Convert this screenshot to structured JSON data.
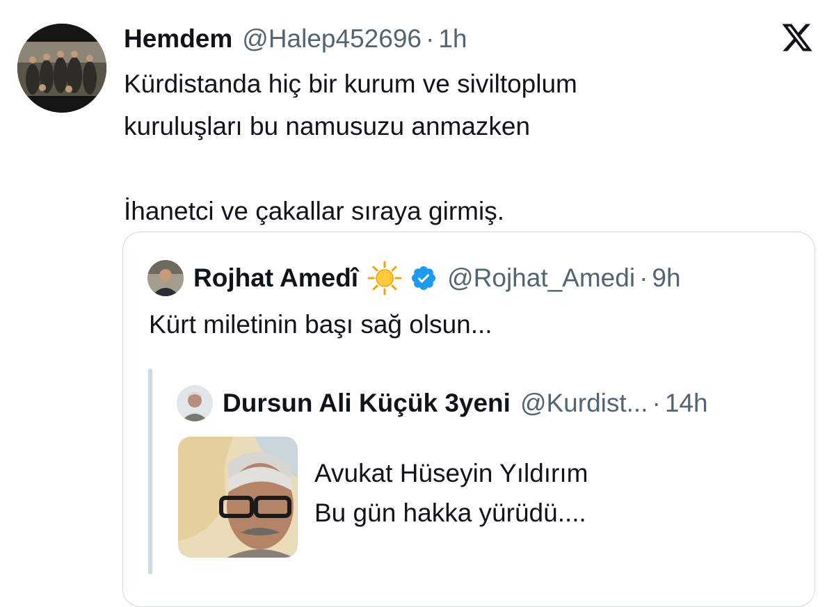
{
  "tweet": {
    "author_name": "Hemdem",
    "handle": "@Halep452696",
    "separator": "·",
    "time": "1h",
    "text_lines": [
      "Kürdistanda hiç bir kurum ve  siviltoplum",
      "kuruluşları bu  namusuzu  anmazken",
      "",
      "İhanetci  ve çakallar sıraya girmiş."
    ]
  },
  "quoted": {
    "author_name": "Rojhat Amedî",
    "handle": "@Rojhat_Amedi",
    "separator": "·",
    "time": "9h",
    "text": "Kürt miletinin başı sağ olsun..."
  },
  "nested": {
    "author_name": "Dursun Ali Küçük 3yeni",
    "handle": "@Kurdist...",
    "separator": "·",
    "time": "14h",
    "text_lines": [
      "Avukat Hüseyin Yıldırım",
      "Bu gün hakka yürüdü...."
    ]
  },
  "icons": {
    "platform_logo": "x-logo-icon",
    "verified": "verified-badge-icon",
    "emoji": "sun-emoji-icon"
  },
  "colors": {
    "text": "#0f1419",
    "secondary": "#536471",
    "verified": "#1d9bf0",
    "border": "#cfd9de"
  }
}
